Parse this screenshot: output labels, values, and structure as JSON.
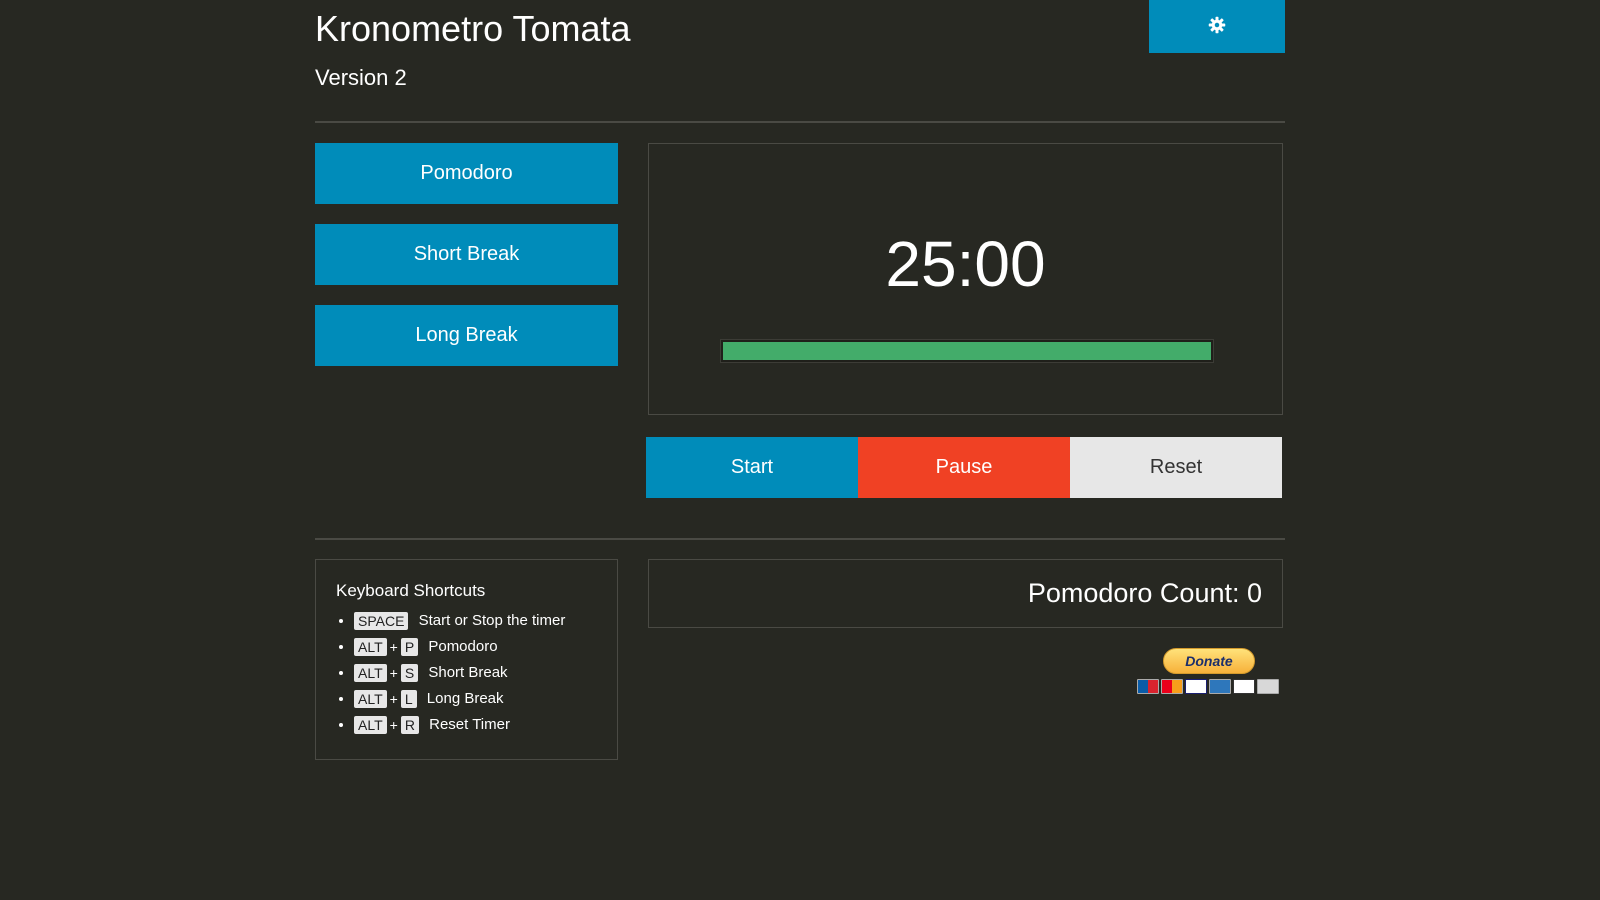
{
  "header": {
    "title": "Kronometro Tomata",
    "subtitle": "Version 2",
    "settings_icon": "gear-icon"
  },
  "modes": [
    {
      "label": "Pomodoro"
    },
    {
      "label": "Short Break"
    },
    {
      "label": "Long Break"
    }
  ],
  "timer": {
    "display": "25:00",
    "progress": 1.0,
    "progress_color": "#43ac6a"
  },
  "controls": {
    "start_label": "Start",
    "pause_label": "Pause",
    "reset_label": "Reset"
  },
  "shortcuts": {
    "title": "Keyboard Shortcuts",
    "items": [
      {
        "keys": [
          "SPACE"
        ],
        "desc": "Start or Stop the timer"
      },
      {
        "keys": [
          "ALT",
          "P"
        ],
        "desc": "Pomodoro"
      },
      {
        "keys": [
          "ALT",
          "S"
        ],
        "desc": "Short Break"
      },
      {
        "keys": [
          "ALT",
          "L"
        ],
        "desc": "Long Break"
      },
      {
        "keys": [
          "ALT",
          "R"
        ],
        "desc": "Reset Timer"
      }
    ],
    "plus": "+"
  },
  "counter": {
    "text": "Pomodoro Count: 0"
  },
  "donate": {
    "label": "Donate",
    "cards": [
      "maestro",
      "mastercard",
      "visa",
      "amex",
      "discover",
      "bank"
    ]
  },
  "colors": {
    "background": "#272822",
    "primary": "#008cba",
    "alert": "#f04124",
    "secondary": "#e7e7e7",
    "success": "#43ac6a"
  }
}
